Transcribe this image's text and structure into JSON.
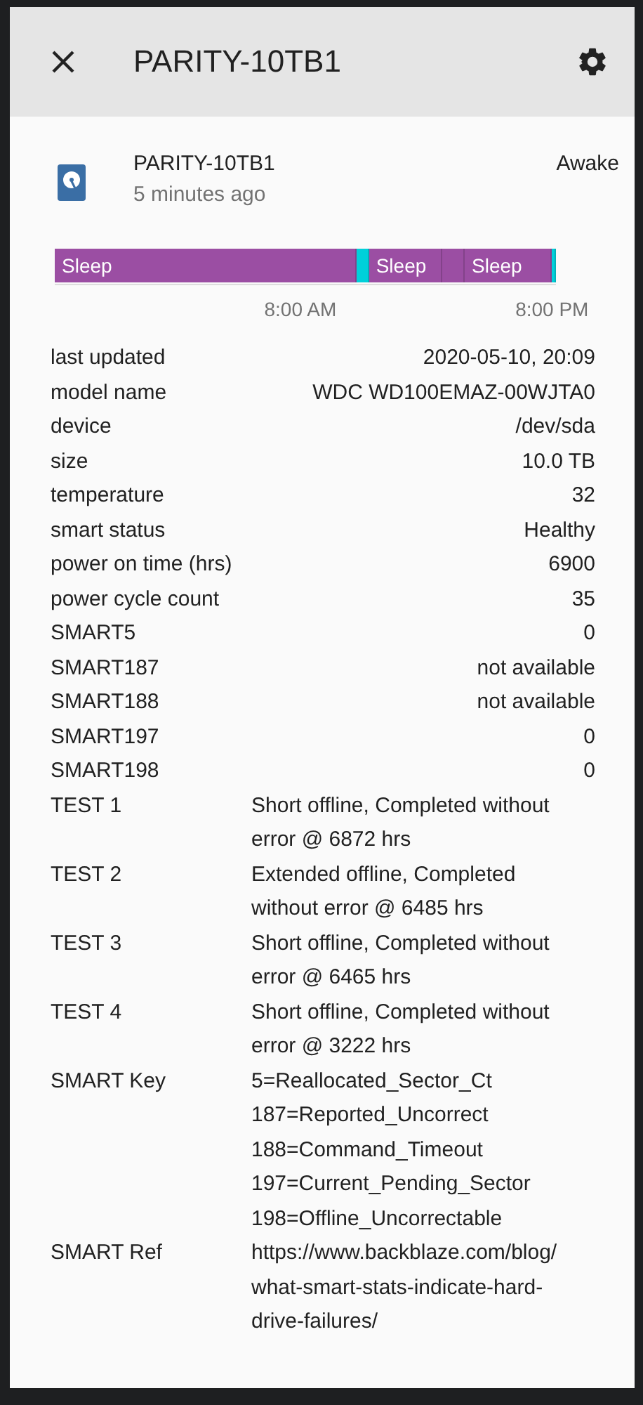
{
  "dialog": {
    "title": "PARITY-10TB1"
  },
  "entity": {
    "name": "PARITY-10TB1",
    "time": "5 minutes ago",
    "state": "Awake"
  },
  "timeline": {
    "segments": [
      {
        "label": "Sleep",
        "color": "#9b4ea3"
      },
      {
        "color": "#00d0da"
      },
      {
        "label": "Sleep",
        "color": "#9b4ea3"
      },
      {
        "color": "#9b4ea3"
      },
      {
        "label": "Sleep",
        "color": "#9b4ea3"
      },
      {
        "color": "#00d0da"
      }
    ],
    "ticks": [
      {
        "label": "8:00 AM"
      },
      {
        "label": "8:00 PM"
      }
    ]
  },
  "attributes": [
    {
      "kind": "pair",
      "label": "last updated",
      "value": "2020-05-10, 20:09"
    },
    {
      "kind": "pair",
      "label": "model name",
      "value": "WDC WD100EMAZ-00WJTA0"
    },
    {
      "kind": "pair",
      "label": "device",
      "value": "/dev/sda"
    },
    {
      "kind": "pair",
      "label": "size",
      "value": "10.0 TB"
    },
    {
      "kind": "pair",
      "label": "temperature",
      "value": "32"
    },
    {
      "kind": "pair",
      "label": "smart status",
      "value": "Healthy"
    },
    {
      "kind": "pair",
      "label": "power on time (hrs)",
      "value": "6900"
    },
    {
      "kind": "pair",
      "label": "power cycle count",
      "value": "35"
    },
    {
      "kind": "pair",
      "label": "SMART5",
      "value": "0"
    },
    {
      "kind": "pair",
      "label": "SMART187",
      "value": "not available"
    },
    {
      "kind": "pair",
      "label": "SMART188",
      "value": "not available"
    },
    {
      "kind": "pair",
      "label": "SMART197",
      "value": "0"
    },
    {
      "kind": "pair",
      "label": "SMART198",
      "value": "0"
    },
    {
      "kind": "long",
      "label": "TEST 1",
      "value": "Short offline, Completed without error @ 6872 hrs"
    },
    {
      "kind": "long",
      "label": "TEST 2",
      "value": "Extended offline, Completed without error @ 6485 hrs"
    },
    {
      "kind": "long",
      "label": "TEST 3",
      "value": "Short offline, Completed without error @ 6465 hrs"
    },
    {
      "kind": "long",
      "label": "TEST 4",
      "value": "Short offline, Completed without error @ 3222 hrs"
    },
    {
      "kind": "lines",
      "label": "SMART Key",
      "lines": [
        "5=Reallocated_Sector_Ct",
        "187=Reported_Uncorrect",
        "188=Command_Timeout",
        "197=Current_Pending_Sector",
        "198=Offline_Uncorrectable"
      ]
    },
    {
      "kind": "long",
      "label": "SMART Ref",
      "value": "https://www.backblaze.com/blog/what-smart-stats-indicate-hard-drive-failures/"
    }
  ]
}
